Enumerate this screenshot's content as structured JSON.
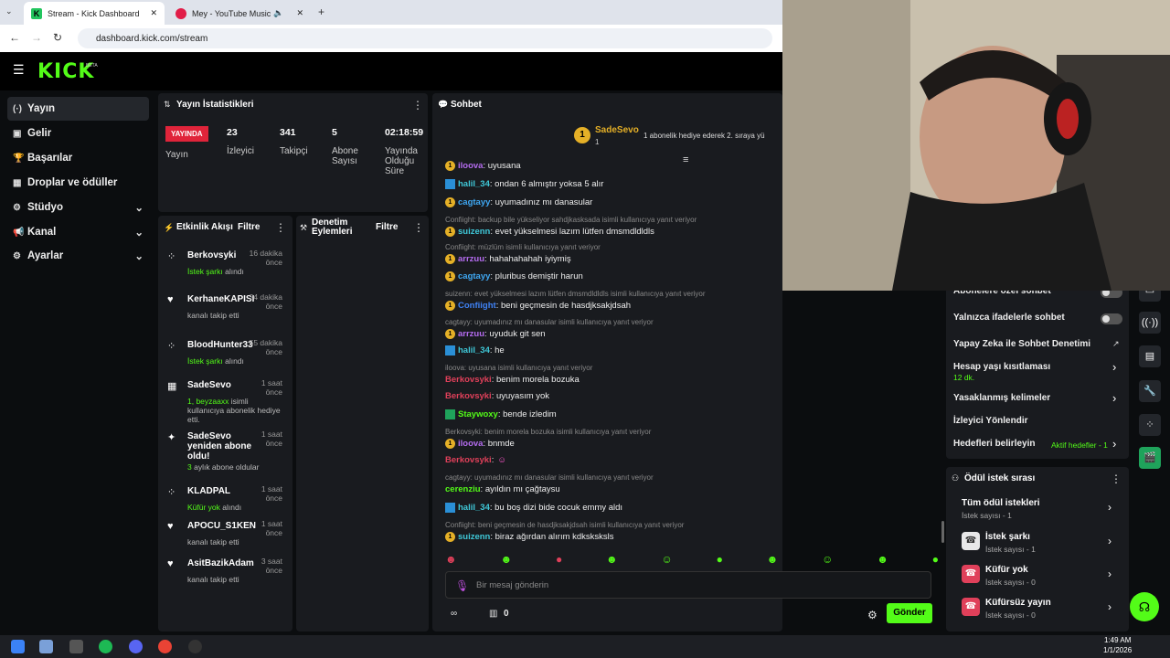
{
  "browser": {
    "tabs": [
      {
        "label": "Stream - Kick Dashboard"
      },
      {
        "label": "Mey - YouTube Music"
      }
    ],
    "url": "dashboard.kick.com/stream"
  },
  "brand": {
    "logo": "KICK",
    "beta": "BETA"
  },
  "sidebar": {
    "items": [
      {
        "label": "Yayın",
        "icon": "broadcast-icon"
      },
      {
        "label": "Gelir",
        "icon": "money-icon"
      },
      {
        "label": "Başarılar",
        "icon": "trophy-icon"
      },
      {
        "label": "Droplar ve ödüller",
        "icon": "gift-icon"
      },
      {
        "label": "Stüdyo",
        "icon": "studio-icon"
      },
      {
        "label": "Kanal",
        "icon": "megaphone-icon"
      },
      {
        "label": "Ayarlar",
        "icon": "gear-icon"
      }
    ]
  },
  "stats": {
    "title": "Yayın İstatistikleri",
    "live": "YAYINDA",
    "live_label": "Yayın",
    "viewers": "23",
    "viewers_label": "İzleyici",
    "followers": "341",
    "followers_label": "Takipçi",
    "subs": "5",
    "subs_label": "Abone Sayısı",
    "uptime": "02:18:59",
    "uptime_label": "Yayında Olduğu Süre"
  },
  "activity": {
    "title": "Etkinlik Akışı",
    "filter": "Filtre",
    "items": [
      {
        "name": "Berkovsyki",
        "desc1": "İstek şarkı",
        "desc2": " alındı",
        "time": "16 dakika önce"
      },
      {
        "name": "KerhaneKAPISI",
        "desc1": "",
        "desc2": "kanalı takip etti",
        "time": "24 dakika önce"
      },
      {
        "name": "BloodHunter33",
        "desc1": "İstek şarkı",
        "desc2": " alındı",
        "time": "55 dakika önce"
      },
      {
        "name": "SadeSevo",
        "desc1": "1, beyzaaxx",
        "desc2": " isimli kullanıcıya abonelik hediye etti.",
        "time": "1 saat önce"
      },
      {
        "name": "SadeSevo yeniden abone oldu!",
        "desc1": "3",
        "desc2": " aylık abone oldular",
        "time": "1 saat önce"
      },
      {
        "name": "KLADPAL",
        "desc1": "Küfür yok",
        "desc2": " alındı",
        "time": "1 saat önce"
      },
      {
        "name": "APOCU_S1KEN",
        "desc1": "",
        "desc2": "kanalı takip etti",
        "time": "1 saat önce"
      },
      {
        "name": "AsitBazikAdam",
        "desc1": "",
        "desc2": "kanalı takip etti",
        "time": "3 saat önce"
      }
    ]
  },
  "moderation": {
    "title": "Denetim Eylemleri",
    "filter": "Filtre"
  },
  "chat": {
    "title": "Sohbet",
    "pinned_user": "SadeSevo",
    "pinned_count": "1",
    "pinned_text": "1 abonelik hediye ederek 2. sıraya yü",
    "placeholder": "Bir mesaj gönderin",
    "send": "Gönder",
    "gift_count": "0",
    "messages": [
      {
        "reply": "",
        "user": "iloova",
        "color": "#b56cf0",
        "text": ": uyusana"
      },
      {
        "reply": "",
        "user": "halil_34",
        "color": "#3fc8d8",
        "text": ": ondan 6 almıştır yoksa 5 alır"
      },
      {
        "reply": "",
        "user": "cagtayy",
        "color": "#3fa9f5",
        "text": ": uyumadınız mı danasular"
      },
      {
        "reply": "Confiight: backup bile yükseliyor sahdjkasksada isimli kullanıcıya yanıt veriyor",
        "user": "suizenn",
        "color": "#3fc8d8",
        "text": ": evet yükselmesi lazım lütfen dmsmdldldls"
      },
      {
        "reply": "Confiight: müzlüm isimli kullanıcıya yanıt veriyor",
        "user": "arrzuu",
        "color": "#b56cf0",
        "text": ": hahahahahah iyiymiş"
      },
      {
        "reply": "",
        "user": "cagtayy",
        "color": "#3fa9f5",
        "text": ": pluribus demiştir harun"
      },
      {
        "reply": "suizenn: evet yükselmesi lazım lütfen dmsmdldldls isimli kullanıcıya yanıt veriyor",
        "user": "Confiight",
        "color": "#3f82f5",
        "text": ": beni geçmesin de hasdjksakjdsah"
      },
      {
        "reply": "cagtayy: uyumadınız mı danasular isimli kullanıcıya yanıt veriyor",
        "user": "arrzuu",
        "color": "#b56cf0",
        "text": ": uyuduk git sen"
      },
      {
        "reply": "",
        "user": "halil_34",
        "color": "#3fc8d8",
        "text": ": he"
      },
      {
        "reply": "iloova: uyusana isimli kullanıcıya yanıt veriyor",
        "user": "Berkovsyki",
        "color": "#e0405a",
        "text": ": benim morela bozuka"
      },
      {
        "reply": "",
        "user": "Berkovsyki",
        "color": "#e0405a",
        "text": ": uyuyasım yok"
      },
      {
        "reply": "",
        "user": "Staywoxy",
        "color": "#53fc18",
        "text": ": bende izledim"
      },
      {
        "reply": "Berkovsyki: benim morela bozuka isimli kullanıcıya yanıt veriyor",
        "user": "iloova",
        "color": "#b56cf0",
        "text": ": bnmde"
      },
      {
        "reply": "",
        "user": "Berkovsyki",
        "color": "#e0405a",
        "text": ":"
      },
      {
        "reply": "cagtayy: uyumadınız mı danasular isimli kullanıcıya yanıt veriyor",
        "user": "cerenziu",
        "color": "#53fc18",
        "text": ": ayıldın mı çağtaysu"
      },
      {
        "reply": "",
        "user": "halil_34",
        "color": "#3fc8d8",
        "text": ": bu boş dizi bide cocuk emmy aldı"
      },
      {
        "reply": "Confiight: beni geçmesin de hasdjksakjdsah isimli kullanıcıya yanıt veriyor",
        "user": "suizenn",
        "color": "#3fc8d8",
        "text": ": biraz ağırdan alırım kdksksksls"
      }
    ]
  },
  "settings": {
    "rows": [
      {
        "label": "Abonelere özel sohbet"
      },
      {
        "label": "Yalnızca ifadelerle sohbet"
      },
      {
        "label": "Yapay Zeka ile Sohbet Denetimi"
      },
      {
        "label": "Hesap yaşı kısıtlaması",
        "sub": "12 dk."
      },
      {
        "label": "Yasaklanmış kelimeler"
      },
      {
        "label": "İzleyici Yönlendir"
      },
      {
        "label": "Hedefleri belirleyin",
        "sub": "Aktif hedefler - 1"
      }
    ]
  },
  "rewards": {
    "title": "Ödül istek sırası",
    "items": [
      {
        "label": "Tüm ödül istekleri",
        "sub": "İstek sayısı - 1"
      },
      {
        "label": "İstek şarkı",
        "sub": "İstek sayısı - 1"
      },
      {
        "label": "Küfür yok",
        "sub": "İstek sayısı - 0"
      },
      {
        "label": "Küfürsüz yayın",
        "sub": "İstek sayısı - 0"
      }
    ]
  },
  "taskbar": {
    "time": "1:49 AM",
    "date": "1/1/2026"
  },
  "colors": {
    "accent": "#53fc18",
    "live": "#e0243a",
    "panel": "#191b1f"
  }
}
